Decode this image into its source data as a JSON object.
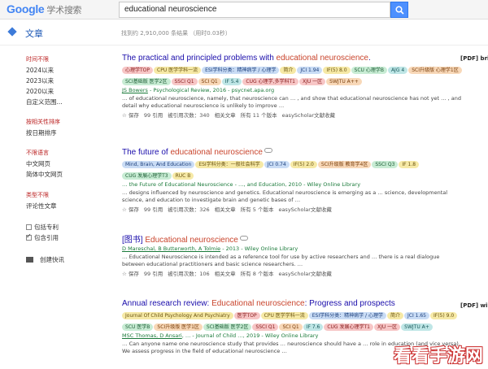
{
  "header": {
    "logo_text": "Google",
    "logo_sub": "学术搜索",
    "query": "educational neuroscience"
  },
  "subbar": {
    "articles_label": "文章",
    "result_count": "找到约 2,910,000 条结果 （用时0.03秒）"
  },
  "sidebar": {
    "time_head": "时间不限",
    "time_items": [
      "2024以来",
      "2023以来",
      "2020以来",
      "自定义范围..."
    ],
    "sort_items": [
      "按相关性排序",
      "按日期排序"
    ],
    "lang_head": "不限语言",
    "lang_items": [
      "中文网页",
      "简体中文网页"
    ],
    "type_head": "类型不限",
    "type_items": [
      "评论性文章"
    ],
    "checkbox_patents": "包括专利",
    "checkbox_citations": "包含引用",
    "create_alert": "创建快讯"
  },
  "results": [
    {
      "title_pre": "The practical and principled problems with ",
      "title_hl": "educational neuroscience",
      "title_post": ".",
      "tags": [
        {
          "text": "心理学TOP",
          "style": "t-red"
        },
        {
          "text": "CPU 医学学科一流",
          "style": "t-yellow"
        },
        {
          "text": "ESI学科分类：精神病学 / 心理学",
          "style": "t-blue"
        },
        {
          "text": "简介",
          "style": "t-yellow"
        },
        {
          "text": "JCI 1.94",
          "style": "t-blue"
        },
        {
          "text": "IF(5) 8.0",
          "style": "t-yellow"
        },
        {
          "text": "SCU 心理学B",
          "style": "t-green"
        },
        {
          "text": "AJG 4",
          "style": "t-teal"
        },
        {
          "text": "SCI升级版 心理学1区",
          "style": "t-orange"
        },
        {
          "text": "SCI基础版 医学2区",
          "style": "t-green"
        },
        {
          "text": "SSCI Q1",
          "style": "t-red"
        },
        {
          "text": "SCI Q1",
          "style": "t-orange"
        },
        {
          "text": "IF 5.4",
          "style": "t-teal"
        },
        {
          "text": "CUG 心理学,多学科T1",
          "style": "t-red"
        },
        {
          "text": "XJU 一区",
          "style": "t-red"
        },
        {
          "text": "SWJTU A++",
          "style": "t-orange"
        }
      ],
      "meta_author": "JS Bowers",
      "meta_rest": " - Psychological Review, 2016 - psycnet.apa.org",
      "snippet": "… of educational neuroscience, namely, that neuroscience can … , and show that educational neuroscience has not yet … , and detail why educational neuroscience is unlikely to improve …",
      "actions": [
        "☆ 保存",
        "99 引用",
        "被引用次数：340",
        "相关文章",
        "所有 11 个版本",
        "easyScholar文献收藏"
      ],
      "side_link": "[PDF] bri"
    },
    {
      "title_pre": "The future of ",
      "title_hl": "educational neuroscience",
      "title_post": "",
      "tags": [
        {
          "text": "Mind, Brain, And Education",
          "style": "t-blue"
        },
        {
          "text": "ESI学科分类：一般社会科学",
          "style": "t-yellow"
        },
        {
          "text": "JCI 0.74",
          "style": "t-blue"
        },
        {
          "text": "IF(5) 2.0",
          "style": "t-yellow"
        },
        {
          "text": "SCI升级版 教育学4区",
          "style": "t-orange"
        },
        {
          "text": "SSCI Q3",
          "style": "t-green"
        },
        {
          "text": "IF 1.8",
          "style": "t-yellow"
        },
        {
          "text": "CUG 发展心理学T3",
          "style": "t-green"
        },
        {
          "text": "RUC B",
          "style": "t-yellow"
        }
      ],
      "meta_author": "",
      "meta_rest": "… the Future of Educational Neuroscience - …, and Education, 2010 - Wiley Online Library",
      "snippet": "… designs influenced by neuroscience and genetics. Educational neuroscience is emerging as a … science, developmental science, and education to investigate brain and genetic bases of …",
      "actions": [
        "☆ 保存",
        "99 引用",
        "被引用次数：326",
        "相关文章",
        "所有 5 个版本",
        "easyScholar文献收藏"
      ],
      "side_link": ""
    },
    {
      "title_pre": "[图书] ",
      "title_hl": "Educational neuroscience",
      "title_post": "",
      "tags": [],
      "meta_author": "D Mareschal, B Butterworth, A Tolmie",
      "meta_rest": " - 2013 - Wiley Online Library",
      "snippet": "… Educational Neuroscience is intended as a reference tool for use by active researchers and … there is a real dialogue between educational practitioners and basic science researchers. …",
      "actions": [
        "☆ 保存",
        "99 引用",
        "被引用次数：106",
        "相关文章",
        "所有 8 个版本",
        "easyScholar文献收藏"
      ],
      "side_link": ""
    },
    {
      "title_pre": "Annual research review: ",
      "title_hl": "Educational neuroscience",
      "title_post": ": Progress and prospects",
      "tags": [
        {
          "text": "Journal Of Child Psychology And Psychiatry",
          "style": "t-yellow"
        },
        {
          "text": "医学TOP",
          "style": "t-red"
        },
        {
          "text": "CPU 医学学科一流",
          "style": "t-yellow"
        },
        {
          "text": "ESI学科分类：精神病学 / 心理学",
          "style": "t-blue"
        },
        {
          "text": "简介",
          "style": "t-yellow"
        },
        {
          "text": "JCI 1.65",
          "style": "t-blue"
        },
        {
          "text": "IF(5) 9.0",
          "style": "t-yellow"
        },
        {
          "text": "SCU 医学B",
          "style": "t-green"
        },
        {
          "text": "SCI升级版 医学1区",
          "style": "t-orange"
        },
        {
          "text": "SCI基础版 医学2区",
          "style": "t-green"
        },
        {
          "text": "SSCI Q1",
          "style": "t-red"
        },
        {
          "text": "SCI Q1",
          "style": "t-orange"
        },
        {
          "text": "IF 7.6",
          "style": "t-teal"
        },
        {
          "text": "CUG 发展心理学T1",
          "style": "t-red"
        },
        {
          "text": "XJU 一区",
          "style": "t-red"
        },
        {
          "text": "SWJTU A+",
          "style": "t-teal"
        }
      ],
      "meta_author": "MSC Thomas, D Ansari",
      "meta_rest": ", … - Journal of Child …, 2019 - Wiley Online Library",
      "snippet": "… Can anyone name one neuroscience study that provides … neuroscience should have a … role in education (and vice versa). We assess progress in the field of educational neuroscience …",
      "actions": [],
      "side_link": "[PDF] wile"
    }
  ],
  "watermark": "看看手游网",
  "colors": {
    "link": "#1a0dab",
    "highlight": "#c9442c",
    "meta_green": "#1a7a3a",
    "search_blue": "#4d90fe"
  }
}
